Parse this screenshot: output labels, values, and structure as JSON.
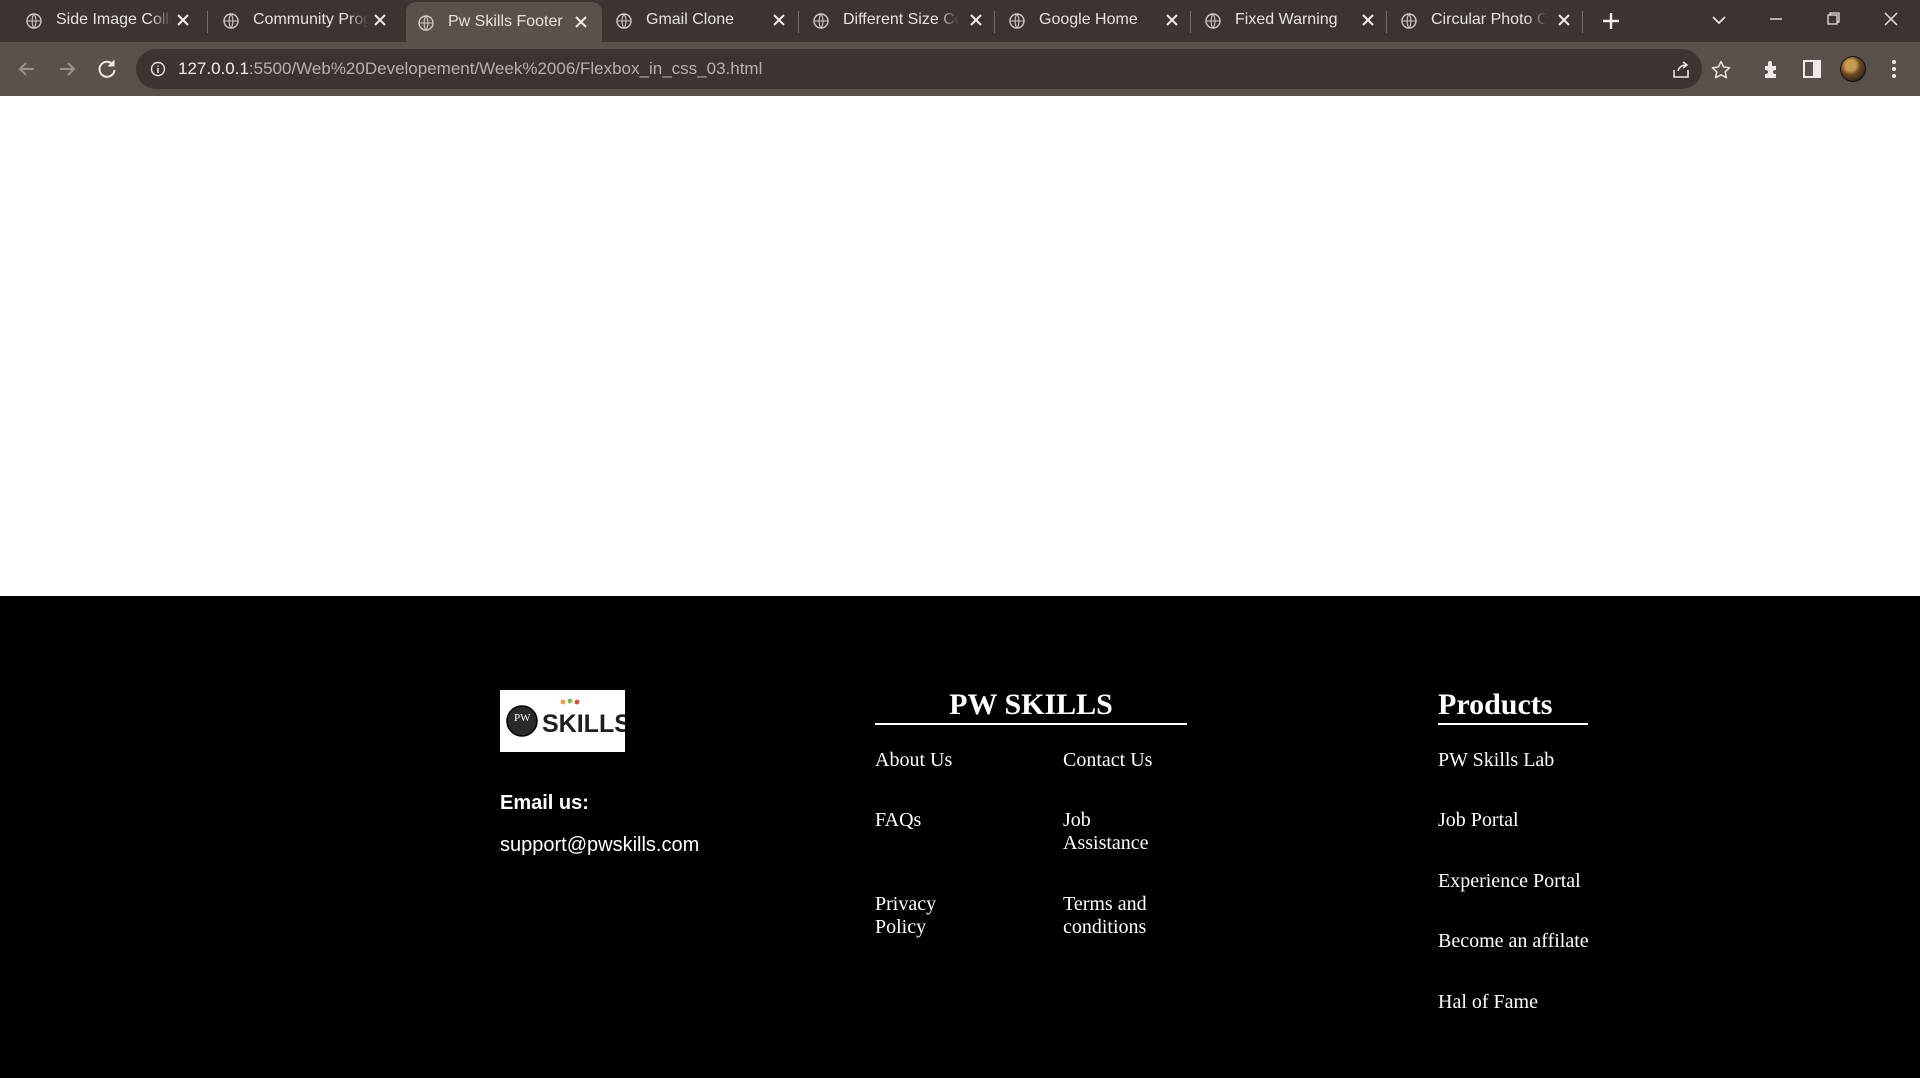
{
  "browser": {
    "tabs": [
      {
        "title": "Side Image Colla"
      },
      {
        "title": "Community Prog"
      },
      {
        "title": "Pw Skills Footer",
        "active": true
      },
      {
        "title": "Gmail Clone"
      },
      {
        "title": "Different Size Co"
      },
      {
        "title": "Google Home"
      },
      {
        "title": "Fixed Warning"
      },
      {
        "title": "Circular Photo C"
      }
    ],
    "url_host": "127.0.0.1",
    "url_rest": ":5500/Web%20Developement/Week%2006/Flexbox_in_css_03.html",
    "colors": {
      "tabstrip": "#3b3431",
      "toolbar": "#5b514c",
      "omnibox": "#3b3431"
    }
  },
  "footer": {
    "logo": {
      "text": "SKILLS",
      "mark": "PW"
    },
    "email_label": "Email us:",
    "email_value": "support@pwskills.com",
    "pw_skills": {
      "heading": "PW SKILLS",
      "links": [
        "About Us",
        "Contact Us",
        "FAQs",
        "Job Assistance",
        "Privacy Policy",
        "Terms and conditions"
      ]
    },
    "products": {
      "heading": "Products",
      "links": [
        "PW Skills Lab",
        "Job Portal",
        "Experience Portal",
        "Become an affilate",
        "Hal of Fame"
      ]
    }
  }
}
